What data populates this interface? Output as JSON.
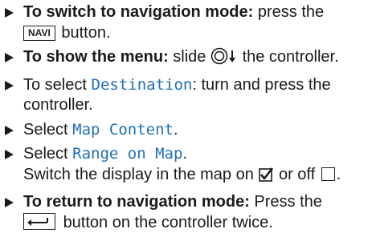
{
  "steps": [
    {
      "lead": "To switch to navigation mode:",
      "before_key": "press the",
      "key_label": "NAVI",
      "after_key": "button."
    },
    {
      "lead": "To show the menu:",
      "before_icon": "slide",
      "icon": "controller-slide-down-icon",
      "after_icon": "the controller."
    },
    {
      "before": "To select",
      "menu_item": "Destination",
      "after": ": turn and press the controller."
    },
    {
      "before": "Select",
      "menu_item": "Map Content",
      "after": "."
    },
    {
      "before": "Select",
      "menu_item": "Range on Map",
      "after": ".",
      "line2_before": "Switch the display in the map on",
      "line2_mid": "or off",
      "line2_after": ".",
      "icons": [
        "checkbox-checked-icon",
        "checkbox-empty-icon"
      ]
    },
    {
      "lead": "To return to navigation mode:",
      "before_key": "Press the",
      "key_icon": "back-arrow-icon",
      "after_key": "button on the controller twice."
    }
  ],
  "colors": {
    "text": "#1a1a1a",
    "menu_item": "#1f6fb5"
  }
}
